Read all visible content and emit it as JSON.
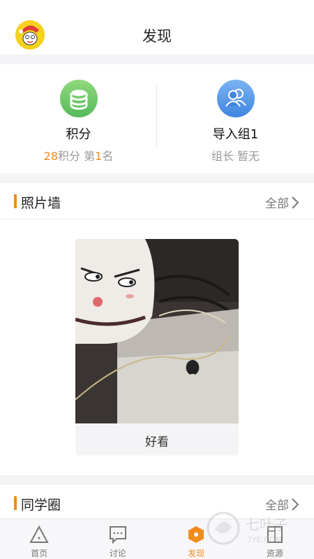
{
  "header": {
    "title": "发现"
  },
  "stats": [
    {
      "title": "积分",
      "sub_value1": "28",
      "sub_text1": "积分 第",
      "sub_value2": "1",
      "sub_text2": "名",
      "icon": "coins-stack-icon",
      "color": "#5cbe5e"
    },
    {
      "title": "导入组1",
      "sub": "组长 暂无",
      "icon": "group-users-icon",
      "color": "#4a8fe4"
    }
  ],
  "photo_wall": {
    "title": "照片墙",
    "more": "全部",
    "photo_caption": "好看"
  },
  "classmates": {
    "title": "同学圈",
    "more": "全部"
  },
  "tabs": [
    {
      "label": "首页",
      "icon": "triangle-home-icon"
    },
    {
      "label": "讨论",
      "icon": "chat-bubble-icon"
    },
    {
      "label": "发现",
      "icon": "hexagon-discover-icon",
      "active": true
    },
    {
      "label": "资源",
      "icon": "folder-resource-icon"
    }
  ],
  "watermark": {
    "text": "七叶子",
    "sub": "7YE.COM"
  },
  "colors": {
    "accent": "#f08c1c",
    "background": "#f4f4f6"
  }
}
